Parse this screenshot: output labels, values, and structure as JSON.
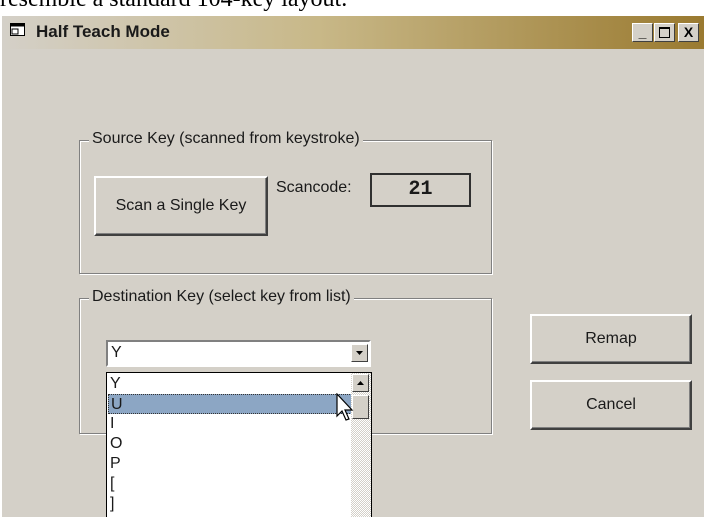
{
  "page_text": "resemble a standard 104-key layout.",
  "window": {
    "title": "Half Teach Mode",
    "controls": {
      "minimize": "_",
      "maximize": "□",
      "close": "X"
    }
  },
  "source_group": {
    "label": "Source Key (scanned from keystroke)",
    "scan_button": "Scan a Single Key",
    "scancode_label": "Scancode:",
    "scancode_value": "21"
  },
  "destination_group": {
    "label": "Destination Key (select key from list)",
    "combo_value": "Y",
    "list_items": [
      "Y",
      "U",
      "I",
      "O",
      "P",
      "[",
      "]"
    ],
    "selected_item": "U"
  },
  "buttons": {
    "remap": "Remap",
    "cancel": "Cancel"
  }
}
